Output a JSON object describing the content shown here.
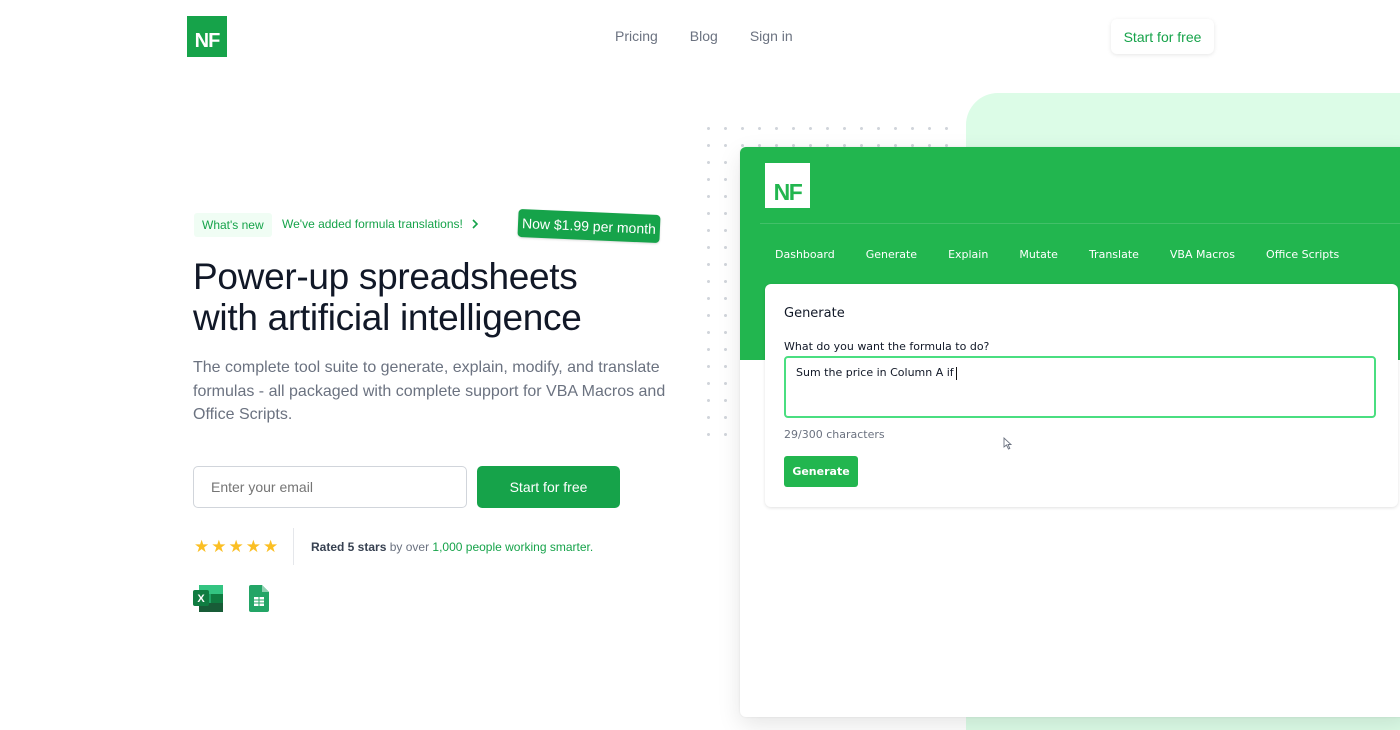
{
  "header": {
    "logo_text": "NF",
    "nav": [
      "Pricing",
      "Blog",
      "Sign in"
    ],
    "cta_label": "Start for free"
  },
  "hero": {
    "whats_new_label": "What's new",
    "announcement": "We've added formula translations!",
    "announcement_icon": "chevron-right-icon",
    "price_badge": "Now $1.99 per month",
    "headline_line1": "Power-up spreadsheets",
    "headline_line2": "with artificial intelligence",
    "subtext": "The complete tool suite to generate, explain, modify, and translate formulas - all packaged with complete support for VBA Macros and Office Scripts.",
    "email_placeholder": "Enter your email",
    "cta_label": "Start for free",
    "rating": {
      "stars": 5,
      "bold": "Rated 5 stars",
      "middle": " by over ",
      "highlight": "1,000 people working smarter."
    },
    "integrations": [
      "excel-icon",
      "google-sheets-icon"
    ]
  },
  "app_preview": {
    "logo_text": "NF",
    "nav": [
      "Dashboard",
      "Generate",
      "Explain",
      "Mutate",
      "Translate",
      "VBA Macros",
      "Office Scripts"
    ],
    "card_title": "Generate",
    "prompt_label": "What do you want the formula to do?",
    "prompt_value": "Sum the price in Column A if",
    "char_count": "29/300 characters",
    "generate_label": "Generate"
  },
  "colors": {
    "brand": "#16a34a",
    "app_green": "#22b64f",
    "mint": "#dcfce7",
    "star": "#fbbf24"
  }
}
